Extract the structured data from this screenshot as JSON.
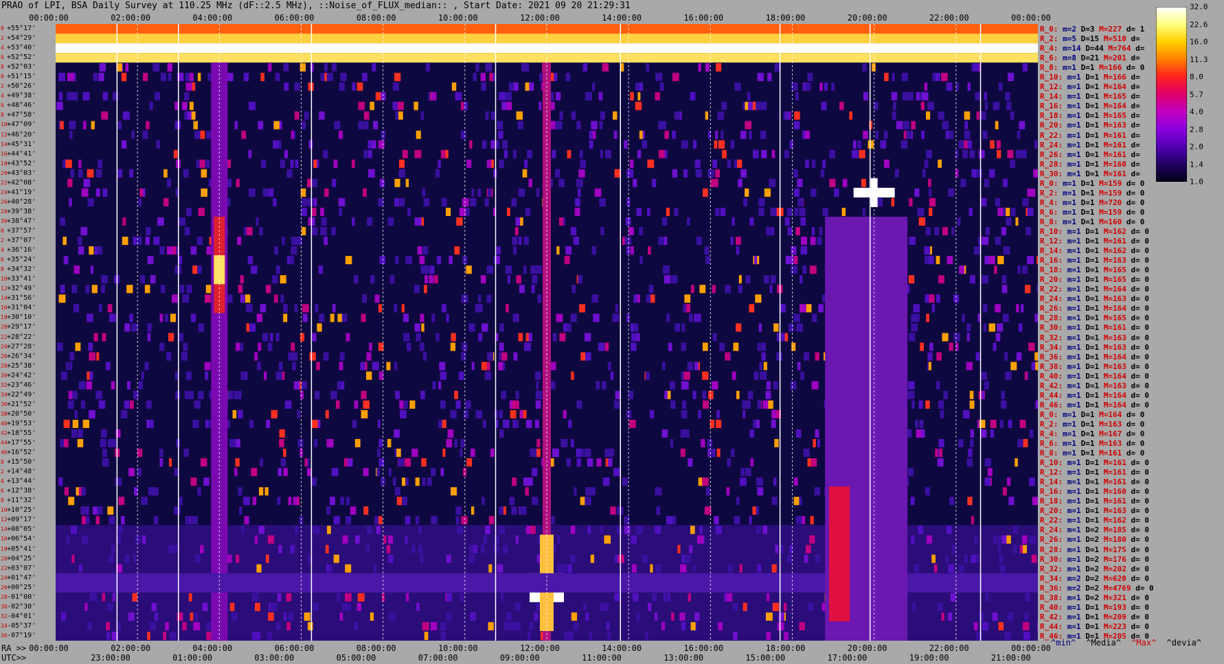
{
  "title": "PRAO of LPI, BSA Daily Survey at 110.25 MHz (dF::2.5 MHz), ::Noise_of_FLUX_median:: , Start Date: 2021 09 20 21:29:31",
  "axis": {
    "top_ticks": [
      "00:00:00",
      "02:00:00",
      "04:00:00",
      "06:00:00",
      "08:00:00",
      "10:00:00",
      "12:00:00",
      "14:00:00",
      "16:00:00",
      "18:00:00",
      "20:00:00",
      "22:00:00",
      "00:00:00"
    ],
    "ra_prefix": "RA >>",
    "ra_ticks": [
      "00:00:00",
      "02:00:00",
      "04:00:00",
      "06:00:00",
      "08:00:00",
      "10:00:00",
      "12:00:00",
      "14:00:00",
      "16:00:00",
      "18:00:00",
      "20:00:00",
      "22:00:00",
      "00:00:00"
    ],
    "utc_prefix": "UTC>>",
    "utc_ticks": [
      "23:00:00",
      "01:00:00",
      "03:00:00",
      "05:00:00",
      "07:00:00",
      "09:00:00",
      "11:00:00",
      "13:00:00",
      "15:00:00",
      "17:00:00",
      "19:00:00",
      "21:00:00"
    ]
  },
  "declinations": [
    "+55°17'",
    "+54°29'",
    "+53°40'",
    "+52°52'",
    "+52°03'",
    "+51°15'",
    "+50°26'",
    "+49°38'",
    "+48°46'",
    "+47°58'",
    "+47°09'",
    "+46°20'",
    "+45°31'",
    "+44°41'",
    "+43°52'",
    "+43°03'",
    "+42°08'",
    "+41°19'",
    "+40°28'",
    "+39°38'",
    "+38°47'",
    "+37°57'",
    "+37°07'",
    "+36°16'",
    "+35°24'",
    "+34°32'",
    "+33°41'",
    "+32°49'",
    "+31°56'",
    "+31°04'",
    "+30°10'",
    "+29°17'",
    "+28°22'",
    "+27°28'",
    "+26°34'",
    "+25°38'",
    "+24°42'",
    "+23°46'",
    "+22°49'",
    "+21°52'",
    "+20°50'",
    "+19°53'",
    "+18°55'",
    "+17°55'",
    "+16°52'",
    "+15°50'",
    "+14°48'",
    "+13°44'",
    "+12°38'",
    "+11°32'",
    "+10°25'",
    "+09°17'",
    "+08°05'",
    "+06°54'",
    "+05°41'",
    "+04°25'",
    "+03°07'",
    "+01°47'",
    "+00°25'",
    "-01°00'",
    "-02°30'",
    "-04°01'",
    "-05°37'",
    "-07°19'"
  ],
  "row_indices": [
    "0",
    "2",
    "4",
    "6",
    "8",
    "0",
    "2",
    "4",
    "6",
    "8",
    "10",
    "12",
    "14",
    "16",
    "18",
    "20",
    "22",
    "24",
    "26",
    "28",
    "30",
    "0",
    "2",
    "4",
    "6",
    "8",
    "10",
    "12",
    "14",
    "16",
    "18",
    "20",
    "22",
    "24",
    "26",
    "28",
    "30",
    "32",
    "34",
    "36",
    "38",
    "40",
    "42",
    "44",
    "46",
    "0",
    "2",
    "4",
    "6",
    "8",
    "10",
    "12",
    "14",
    "16",
    "18",
    "20",
    "22",
    "24",
    "26",
    "28",
    "30",
    "32",
    "34",
    "36"
  ],
  "stats": [
    {
      "r": "R_0:",
      "m": "m=2",
      "d": "D=3",
      "mx": "M=227",
      "dv": "d= 1"
    },
    {
      "r": "R_2:",
      "m": "m=5",
      "d": "D=15",
      "mx": "M=510",
      "dv": "d="
    },
    {
      "r": "R_4:",
      "m": "m=14",
      "d": "D=44",
      "mx": "M=764",
      "dv": "d="
    },
    {
      "r": "R_6:",
      "m": "m=8",
      "d": "D=21",
      "mx": "M=201",
      "dv": "d="
    },
    {
      "r": "R_8:",
      "m": "m=1",
      "d": "D=1",
      "mx": "M=166",
      "dv": "d= 0"
    },
    {
      "r": "R_10:",
      "m": "m=1",
      "d": "D=1",
      "mx": "M=166",
      "dv": "d="
    },
    {
      "r": "R_12:",
      "m": "m=1",
      "d": "D=1",
      "mx": "M=164",
      "dv": "d="
    },
    {
      "r": "R_14:",
      "m": "m=1",
      "d": "D=1",
      "mx": "M=165",
      "dv": "d="
    },
    {
      "r": "R_16:",
      "m": "m=1",
      "d": "D=1",
      "mx": "M=164",
      "dv": "d="
    },
    {
      "r": "R_18:",
      "m": "m=1",
      "d": "D=1",
      "mx": "M=165",
      "dv": "d="
    },
    {
      "r": "R_20:",
      "m": "m=1",
      "d": "D=1",
      "mx": "M=163",
      "dv": "d="
    },
    {
      "r": "R_22:",
      "m": "m=1",
      "d": "D=1",
      "mx": "M=161",
      "dv": "d="
    },
    {
      "r": "R_24:",
      "m": "m=1",
      "d": "D=1",
      "mx": "M=161",
      "dv": "d="
    },
    {
      "r": "R_26:",
      "m": "m=1",
      "d": "D=1",
      "mx": "M=161",
      "dv": "d="
    },
    {
      "r": "R_28:",
      "m": "m=1",
      "d": "D=1",
      "mx": "M=160",
      "dv": "d="
    },
    {
      "r": "R_30:",
      "m": "m=1",
      "d": "D=1",
      "mx": "M=161",
      "dv": "d="
    },
    {
      "r": "R_0:",
      "m": "m=1",
      "d": "D=1",
      "mx": "M=159",
      "dv": "d= 0"
    },
    {
      "r": "R_2:",
      "m": "m=1",
      "d": "D=1",
      "mx": "M=159",
      "dv": "d= 0"
    },
    {
      "r": "R_4:",
      "m": "m=1",
      "d": "D=1",
      "mx": "M=720",
      "dv": "d= 0"
    },
    {
      "r": "R_6:",
      "m": "m=1",
      "d": "D=1",
      "mx": "M=159",
      "dv": "d= 0"
    },
    {
      "r": "R_8:",
      "m": "m=1",
      "d": "D=1",
      "mx": "M=160",
      "dv": "d= 0"
    },
    {
      "r": "R_10:",
      "m": "m=1",
      "d": "D=1",
      "mx": "M=162",
      "dv": "d= 0"
    },
    {
      "r": "R_12:",
      "m": "m=1",
      "d": "D=1",
      "mx": "M=161",
      "dv": "d= 0"
    },
    {
      "r": "R_14:",
      "m": "m=1",
      "d": "D=1",
      "mx": "M=162",
      "dv": "d= 0"
    },
    {
      "r": "R_16:",
      "m": "m=1",
      "d": "D=1",
      "mx": "M=163",
      "dv": "d= 0"
    },
    {
      "r": "R_18:",
      "m": "m=1",
      "d": "D=1",
      "mx": "M=165",
      "dv": "d= 0"
    },
    {
      "r": "R_20:",
      "m": "m=1",
      "d": "D=1",
      "mx": "M=165",
      "dv": "d= 0"
    },
    {
      "r": "R_22:",
      "m": "m=1",
      "d": "D=1",
      "mx": "M=164",
      "dv": "d= 0"
    },
    {
      "r": "R_24:",
      "m": "m=1",
      "d": "D=1",
      "mx": "M=163",
      "dv": "d= 0"
    },
    {
      "r": "R_26:",
      "m": "m=1",
      "d": "D=1",
      "mx": "M=164",
      "dv": "d= 0"
    },
    {
      "r": "R_28:",
      "m": "m=1",
      "d": "D=1",
      "mx": "M=165",
      "dv": "d= 0"
    },
    {
      "r": "R_30:",
      "m": "m=1",
      "d": "D=1",
      "mx": "M=161",
      "dv": "d= 0"
    },
    {
      "r": "R_32:",
      "m": "m=1",
      "d": "D=1",
      "mx": "M=163",
      "dv": "d= 0"
    },
    {
      "r": "R_34:",
      "m": "m=1",
      "d": "D=1",
      "mx": "M=163",
      "dv": "d= 0"
    },
    {
      "r": "R_36:",
      "m": "m=1",
      "d": "D=1",
      "mx": "M=164",
      "dv": "d= 0"
    },
    {
      "r": "R_38:",
      "m": "m=1",
      "d": "D=1",
      "mx": "M=163",
      "dv": "d= 0"
    },
    {
      "r": "R_40:",
      "m": "m=1",
      "d": "D=1",
      "mx": "M=164",
      "dv": "d= 0"
    },
    {
      "r": "R_42:",
      "m": "m=1",
      "d": "D=1",
      "mx": "M=163",
      "dv": "d= 0"
    },
    {
      "r": "R_44:",
      "m": "m=1",
      "d": "D=1",
      "mx": "M=164",
      "dv": "d= 0"
    },
    {
      "r": "R_46:",
      "m": "m=1",
      "d": "D=1",
      "mx": "M=164",
      "dv": "d= 0"
    },
    {
      "r": "R_0:",
      "m": "m=1",
      "d": "D=1",
      "mx": "M=164",
      "dv": "d= 0"
    },
    {
      "r": "R_2:",
      "m": "m=1",
      "d": "D=1",
      "mx": "M=163",
      "dv": "d= 0"
    },
    {
      "r": "R_4:",
      "m": "m=1",
      "d": "D=1",
      "mx": "M=167",
      "dv": "d= 0"
    },
    {
      "r": "R_6:",
      "m": "m=1",
      "d": "D=1",
      "mx": "M=163",
      "dv": "d= 0"
    },
    {
      "r": "R_8:",
      "m": "m=1",
      "d": "D=1",
      "mx": "M=161",
      "dv": "d= 0"
    },
    {
      "r": "R_10:",
      "m": "m=1",
      "d": "D=1",
      "mx": "M=161",
      "dv": "d= 0"
    },
    {
      "r": "R_12:",
      "m": "m=1",
      "d": "D=1",
      "mx": "M=161",
      "dv": "d= 0"
    },
    {
      "r": "R_14:",
      "m": "m=1",
      "d": "D=1",
      "mx": "M=161",
      "dv": "d= 0"
    },
    {
      "r": "R_16:",
      "m": "m=1",
      "d": "D=1",
      "mx": "M=160",
      "dv": "d= 0"
    },
    {
      "r": "R_18:",
      "m": "m=1",
      "d": "D=1",
      "mx": "M=161",
      "dv": "d= 0"
    },
    {
      "r": "R_20:",
      "m": "m=1",
      "d": "D=1",
      "mx": "M=163",
      "dv": "d= 0"
    },
    {
      "r": "R_22:",
      "m": "m=1",
      "d": "D=1",
      "mx": "M=162",
      "dv": "d= 0"
    },
    {
      "r": "R_24:",
      "m": "m=1",
      "d": "D=2",
      "mx": "M=185",
      "dv": "d= 0"
    },
    {
      "r": "R_26:",
      "m": "m=1",
      "d": "D=2",
      "mx": "M=180",
      "dv": "d= 0"
    },
    {
      "r": "R_28:",
      "m": "m=1",
      "d": "D=1",
      "mx": "M=175",
      "dv": "d= 0"
    },
    {
      "r": "R_30:",
      "m": "m=1",
      "d": "D=2",
      "mx": "M=176",
      "dv": "d= 0"
    },
    {
      "r": "R_32:",
      "m": "m=1",
      "d": "D=2",
      "mx": "M=202",
      "dv": "d= 0"
    },
    {
      "r": "R_34:",
      "m": "m=2",
      "d": "D=2",
      "mx": "M=620",
      "dv": "d= 0"
    },
    {
      "r": "R_36:",
      "m": "m=2",
      "d": "D=2",
      "mx": "M=4769",
      "dv": "d= 0"
    },
    {
      "r": "R_38:",
      "m": "m=1",
      "d": "D=2",
      "mx": "M=321",
      "dv": "d= 0"
    },
    {
      "r": "R_40:",
      "m": "m=1",
      "d": "D=1",
      "mx": "M=193",
      "dv": "d= 0"
    },
    {
      "r": "R_42:",
      "m": "m=1",
      "d": "D=1",
      "mx": "M=209",
      "dv": "d= 0"
    },
    {
      "r": "R_44:",
      "m": "m=1",
      "d": "D=1",
      "mx": "M=223",
      "dv": "d= 0"
    },
    {
      "r": "R_46:",
      "m": "m=1",
      "d": "D=1",
      "mx": "M=205",
      "dv": "d= 0"
    }
  ],
  "colorbar": {
    "ticks": [
      "32.0",
      "22.6",
      "16.0",
      "11.3",
      "8.0",
      "5.7",
      "4.0",
      "2.8",
      "2.0",
      "1.4",
      "1.0"
    ],
    "stops": [
      "#ffffff",
      "#ffff80",
      "#ffd000",
      "#ff8000",
      "#ff2020",
      "#e0006a",
      "#c000c0",
      "#8a00e0",
      "#5000b0",
      "#200060",
      "#000018"
    ]
  },
  "footer": {
    "min": "^min^",
    "median": "^Media^",
    "max": "^Max^",
    "devia": "^devia^"
  },
  "chart_data": {
    "type": "heatmap",
    "title": "PRAO of LPI, BSA Daily Survey at 110.25 MHz (dF::2.5 MHz), ::Noise_of_FLUX_median:: , Start Date: 2021 09 20 21:29:31",
    "x_axis": "RA 00:00:00 to 00:00:00 (24 h)",
    "y_axis": "Declination +55°17' to -07°19'",
    "n_beams": 64,
    "color_scale": [
      1.0,
      32.0
    ],
    "features": [
      {
        "name": "bright top rows",
        "dec_range": [
          "+55°17'",
          "+52°52'"
        ]
      },
      {
        "name": "bright source",
        "ra": "12:00:00",
        "dec": "+00°25'",
        "max": 4769
      },
      {
        "name": "bright source",
        "ra": "20:00:00",
        "dec": "+41°19'",
        "max": 720
      }
    ]
  }
}
